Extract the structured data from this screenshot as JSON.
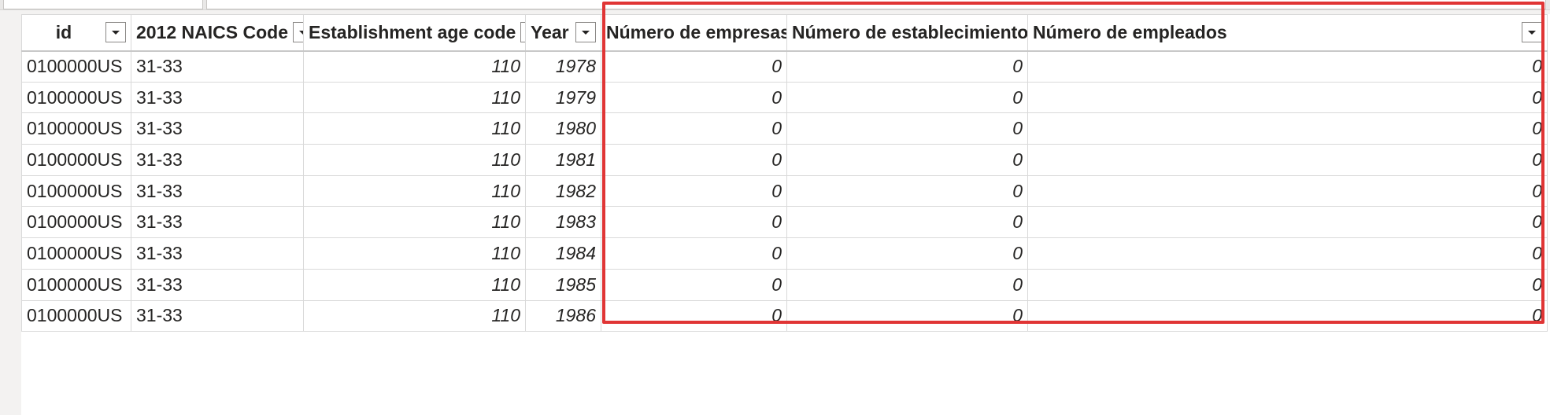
{
  "table": {
    "columns": [
      {
        "label": "id",
        "align": "center"
      },
      {
        "label": "2012 NAICS Code",
        "align": "left"
      },
      {
        "label": "Establishment age code",
        "align": "left"
      },
      {
        "label": "Year",
        "align": "left"
      },
      {
        "label": "Número de empresas",
        "align": "left"
      },
      {
        "label": "Número de establecimientos",
        "align": "left"
      },
      {
        "label": "Número de empleados",
        "align": "left"
      }
    ],
    "rows": [
      [
        "0100000US",
        "31-33",
        "110",
        "1978",
        "0",
        "0",
        "0"
      ],
      [
        "0100000US",
        "31-33",
        "110",
        "1979",
        "0",
        "0",
        "0"
      ],
      [
        "0100000US",
        "31-33",
        "110",
        "1980",
        "0",
        "0",
        "0"
      ],
      [
        "0100000US",
        "31-33",
        "110",
        "1981",
        "0",
        "0",
        "0"
      ],
      [
        "0100000US",
        "31-33",
        "110",
        "1982",
        "0",
        "0",
        "0"
      ],
      [
        "0100000US",
        "31-33",
        "110",
        "1983",
        "0",
        "0",
        "0"
      ],
      [
        "0100000US",
        "31-33",
        "110",
        "1984",
        "0",
        "0",
        "0"
      ],
      [
        "0100000US",
        "31-33",
        "110",
        "1985",
        "0",
        "0",
        "0"
      ],
      [
        "0100000US",
        "31-33",
        "110",
        "1986",
        "0",
        "0",
        "0"
      ]
    ]
  },
  "icons": {
    "column_dropdown": "chevron-down-icon"
  },
  "colors": {
    "highlight_border": "#e03535",
    "grid_line": "#d9d9d9"
  }
}
